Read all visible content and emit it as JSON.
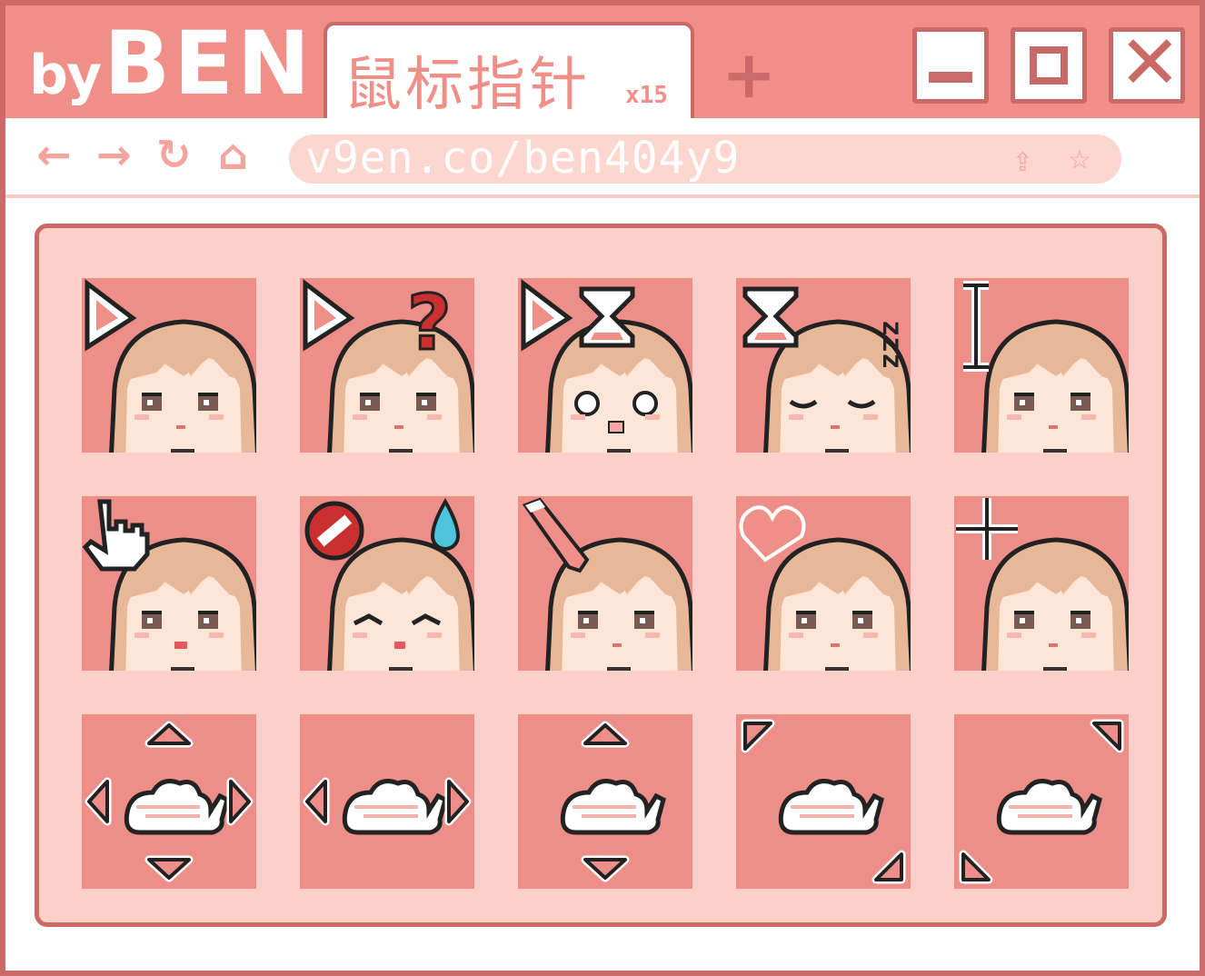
{
  "brand": {
    "by": "by",
    "name": "BEN"
  },
  "tab": {
    "title": "鼠标指针",
    "count": "x15"
  },
  "new_tab": "+",
  "window_controls": {
    "minimize_icon": "minimize-icon",
    "maximize_icon": "maximize-icon",
    "close_icon": "close-icon"
  },
  "nav": {
    "back": "←",
    "forward": "→",
    "reload": "↻",
    "home": "⌂",
    "share": "⇪",
    "star": "☆"
  },
  "address": {
    "url": "v9en.co/ben404y9"
  },
  "colors": {
    "accent": "#f08f88",
    "border": "#c96a66",
    "panel": "#fcd0c8",
    "tile": "#ed8f88",
    "hair": "#e6b898",
    "skin": "#fde6d8"
  },
  "cursors": [
    {
      "name": "normal-select",
      "icon": "arrow-icon",
      "face": "smile"
    },
    {
      "name": "help-select",
      "icon": "question-mark-icon",
      "face": "smile"
    },
    {
      "name": "working-in-background",
      "icon": "hourglass-icon",
      "face": "surprised"
    },
    {
      "name": "busy",
      "icon": "hourglass-zzz-icon",
      "face": "sleeping"
    },
    {
      "name": "text-select",
      "icon": "text-beam-icon",
      "face": "smile"
    },
    {
      "name": "link-select",
      "icon": "pointing-hand-icon",
      "face": "happy"
    },
    {
      "name": "unavailable",
      "icon": "no-entry-icon",
      "face": "wink"
    },
    {
      "name": "handwriting",
      "icon": "pen-icon",
      "face": "smile"
    },
    {
      "name": "alternate-select",
      "icon": "heart-icon",
      "face": "smile"
    },
    {
      "name": "precision-select",
      "icon": "crosshair-icon",
      "face": "smile"
    },
    {
      "name": "move",
      "icon": "arrows-four-icon",
      "face": "hand"
    },
    {
      "name": "horizontal-resize",
      "icon": "arrows-horizontal-icon",
      "face": "hand"
    },
    {
      "name": "vertical-resize",
      "icon": "arrows-vertical-icon",
      "face": "hand"
    },
    {
      "name": "diagonal-resize-1",
      "icon": "arrows-diagonal-1-icon",
      "face": "hand"
    },
    {
      "name": "diagonal-resize-2",
      "icon": "arrows-diagonal-2-icon",
      "face": "hand"
    }
  ]
}
